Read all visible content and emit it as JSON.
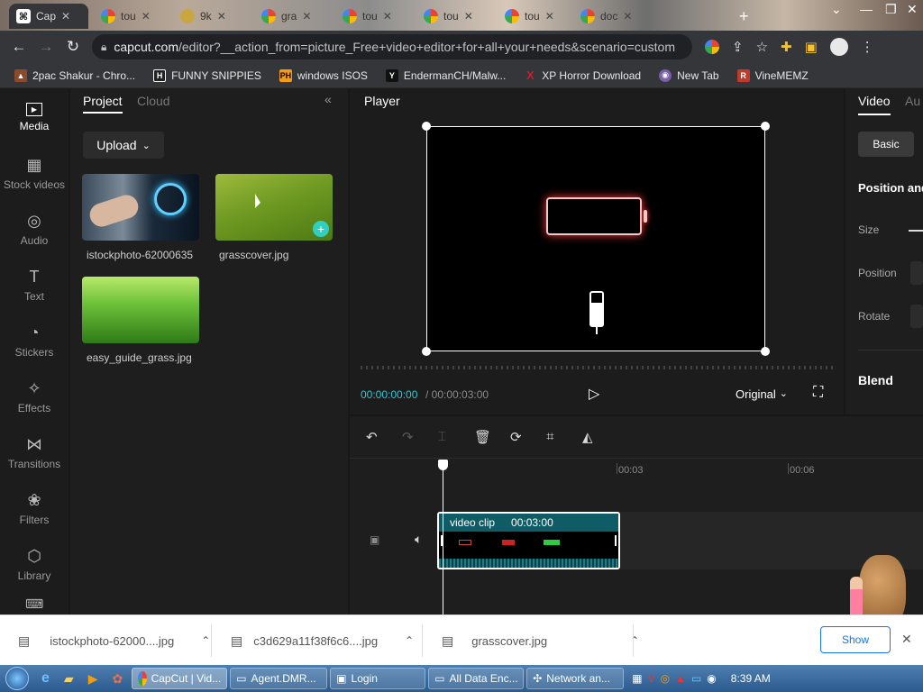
{
  "browser": {
    "tabs": [
      {
        "label": "Cap",
        "icon": "capcut-icon",
        "active": true
      },
      {
        "label": "tou",
        "icon": "google-icon"
      },
      {
        "label": "9k",
        "icon": "page-icon"
      },
      {
        "label": "gra",
        "icon": "google-icon"
      },
      {
        "label": "tou",
        "icon": "google-icon"
      },
      {
        "label": "tou",
        "icon": "google-icon"
      },
      {
        "label": "tou",
        "icon": "google-icon"
      },
      {
        "label": "doc",
        "icon": "google-icon"
      }
    ],
    "new_tab": "+",
    "url_domain": "capcut.com",
    "url_path": "/editor?__action_from=picture_Free+video+editor+for+all+your+needs&scenario=custom",
    "bookmarks": [
      {
        "label": "2pac Shakur - Chro...",
        "color": "#8b4a2b",
        "glyph": "▲"
      },
      {
        "label": "FUNNY SNIPPIES",
        "color": "#222222",
        "glyph": "H"
      },
      {
        "label": "windows ISOS",
        "color": "#f39c12",
        "glyph": "PH"
      },
      {
        "label": "EndermanCH/Malw...",
        "color": "#111111",
        "glyph": "Y"
      },
      {
        "label": "XP Horror Download",
        "color": "#d11a2a",
        "glyph": "X"
      },
      {
        "label": "New Tab",
        "color": "#7a5ea8",
        "glyph": "◉"
      },
      {
        "label": "VineMEMZ",
        "color": "#c0392b",
        "glyph": "R"
      }
    ]
  },
  "capcut": {
    "nav": [
      {
        "label": "Media",
        "icon": "media-icon",
        "glyph": "▶",
        "active": true
      },
      {
        "label": "Stock videos",
        "icon": "stock-videos-icon",
        "glyph": "▦"
      },
      {
        "label": "Audio",
        "icon": "audio-icon",
        "glyph": "◎"
      },
      {
        "label": "Text",
        "icon": "text-icon",
        "glyph": "T"
      },
      {
        "label": "Stickers",
        "icon": "stickers-icon",
        "glyph": "◔"
      },
      {
        "label": "Effects",
        "icon": "effects-icon",
        "glyph": "✧"
      },
      {
        "label": "Transitions",
        "icon": "transitions-icon",
        "glyph": "⋈"
      },
      {
        "label": "Filters",
        "icon": "filters-icon",
        "glyph": "❀"
      },
      {
        "label": "Library",
        "icon": "library-icon",
        "glyph": "⬡"
      }
    ],
    "media_tabs": {
      "project": "Project",
      "cloud": "Cloud"
    },
    "upload_label": "Upload",
    "media_items": [
      {
        "name": "istockphoto-62000635"
      },
      {
        "name": "grasscover.jpg"
      },
      {
        "name": "easy_guide_grass.jpg"
      }
    ],
    "player": {
      "title": "Player",
      "current_time": "00:00:00:00",
      "total_time": "/ 00:00:03:00",
      "ratio": "Original"
    },
    "right_panel": {
      "tab_video": "Video",
      "tab_audio": "Au",
      "basic_tab": "Basic",
      "section": "Position and",
      "size": "Size",
      "position": "Position",
      "rotate": "Rotate",
      "blend": "Blend"
    },
    "timeline": {
      "ruler": [
        "00:03",
        "00:06"
      ],
      "clip_title": "video clip",
      "clip_duration": "00:03:00"
    }
  },
  "downloads": [
    {
      "file": "istockphoto-62000....jpg"
    },
    {
      "file": "c3d629a11f38f6c6....jpg"
    },
    {
      "file": "grasscover.jpg"
    }
  ],
  "taskbar": {
    "items": [
      {
        "label": "CapCut | Vid..."
      },
      {
        "label": "Agent.DMR..."
      },
      {
        "label": "Login"
      },
      {
        "label": "All Data Enc..."
      },
      {
        "label": "Network an..."
      }
    ],
    "clock": "8:39 AM",
    "overlay_button": "Show"
  }
}
